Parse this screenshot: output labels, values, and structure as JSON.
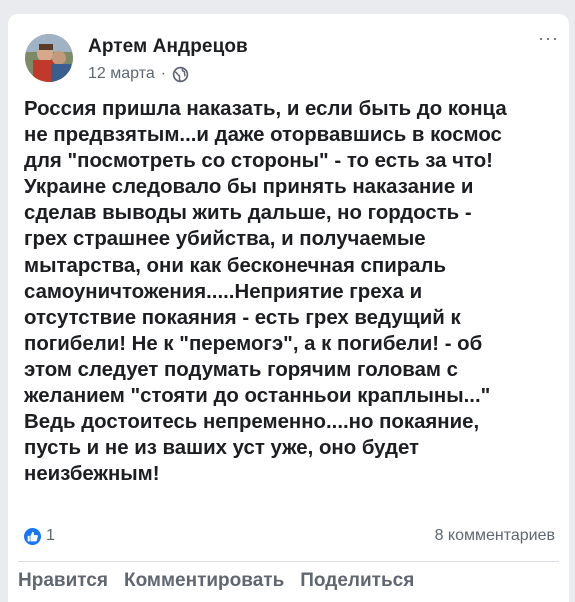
{
  "post": {
    "author": "Артем Андрецов",
    "date": "12 марта",
    "separator": "·",
    "privacy_icon": "globe-icon",
    "more_label": "···",
    "text": "Россия пришла наказать, и если быть до конца\nне предвзятым...и даже оторвавшись в космос\nдля \"посмотреть со стороны\" - то есть за что!\nУкраине следовало бы принять наказание и\nсделав выводы жить дальше, но гордость -\nгрех страшнее убийства, и получаемые\nмытарства, они как бесконечная спираль\nсамоуничтожения.....Неприятие греха и\nотсутствие покаяния - есть грех ведущий к\nпогибели! Не к \"перемогэ\", а к погибели! - об\nэтом следует подумать горячим головам с\nжеланием \"стояти до останньои краплыны...\"\nВедь достоитесь непременно....но покаяние,\nпусть и не из ваших уст уже, оно будет\nнеизбежным!"
  },
  "stats": {
    "reaction_icon": "like-icon",
    "reaction_count": "1",
    "comments": "8 комментариев"
  },
  "actions": {
    "like": "Нравится",
    "comment": "Комментировать",
    "share": "Поделиться"
  },
  "colors": {
    "accent": "#1877f2",
    "text": "#1c1e21",
    "secondary": "#606770",
    "background": "#e9ebee"
  }
}
